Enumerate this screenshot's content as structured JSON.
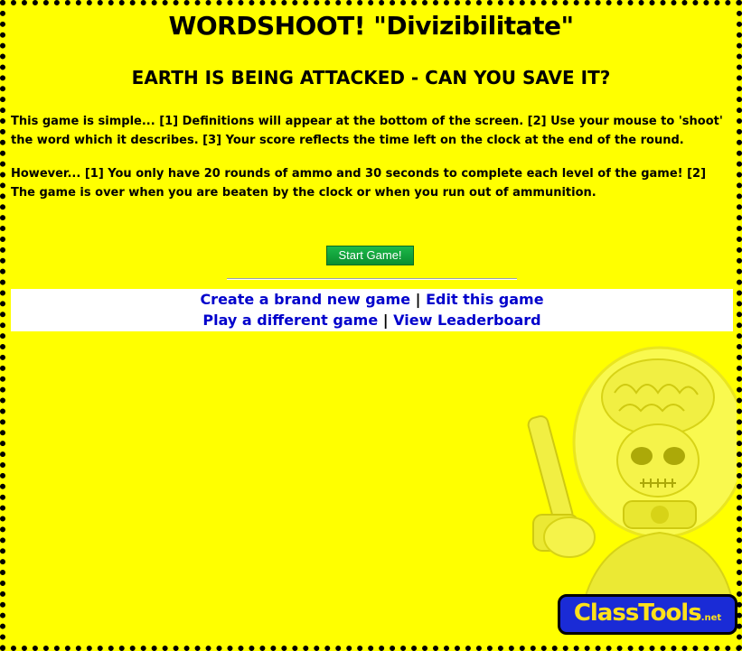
{
  "game": {
    "title": "WORDSHOOT! \"Divizibilitate\"",
    "subtitle": "EARTH IS BEING ATTACKED - CAN YOU SAVE IT?",
    "instructions": "This game is simple... [1] Definitions will appear at the bottom of the screen. [2] Use your mouse to 'shoot' the word which it describes. [3] Your score reflects the time left on the clock at the end of the round.",
    "warning": "However... [1] You only have 20 rounds of ammo and 30 seconds to complete each level of the game! [2] The game is over when you are beaten by the clock or when you run out of ammunition.",
    "start_label": "Start Game!"
  },
  "links": {
    "create_new": "Create a brand new game",
    "edit": "Edit this game",
    "play_different": "Play a different game",
    "leaderboard": "View Leaderboard",
    "separator": "|"
  },
  "logo": {
    "main": "ClassTools",
    "suffix": ".net"
  },
  "colors": {
    "background": "#ffff00",
    "link": "#0000cc",
    "button": "#0a8f2f",
    "logo_bg": "#1a2bd6",
    "logo_text": "#ffe11a"
  },
  "icons": {
    "decoration": "martian-alien-illustration"
  }
}
